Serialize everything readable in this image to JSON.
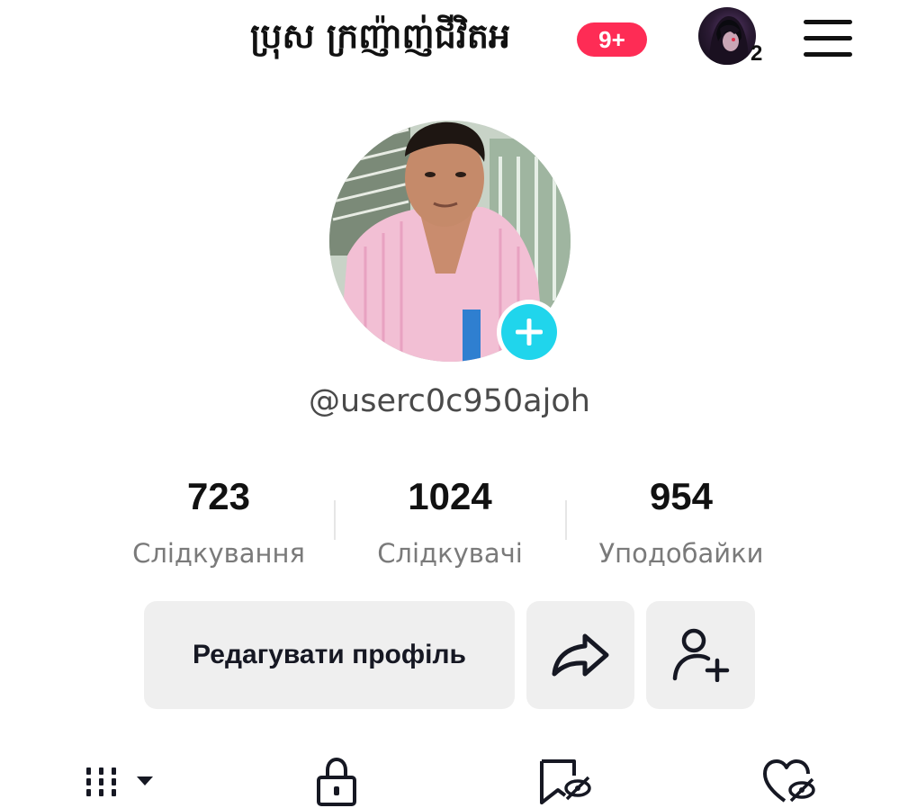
{
  "header": {
    "title": "ប្រុស ក្រញ៉ាញ់ជីវិតអ",
    "notification_badge": "9+",
    "account_count": "2"
  },
  "profile": {
    "username": "@userc0c950ajoh"
  },
  "stats": [
    {
      "value": "723",
      "label": "Слідкування"
    },
    {
      "value": "1024",
      "label": "Слідкувачі"
    },
    {
      "value": "954",
      "label": "Уподобайки"
    }
  ],
  "actions": {
    "edit_label": "Редагувати профіль"
  },
  "tabs": [
    {
      "icon": "videos-grid-icon"
    },
    {
      "icon": "lock-icon"
    },
    {
      "icon": "bookmark-hidden-icon"
    },
    {
      "icon": "heart-hidden-icon"
    }
  ],
  "colors": {
    "badge": "#fe2c55",
    "add_avatar": "#20d5ec",
    "button_bg": "#efefef",
    "label_gray": "#7a7a7a"
  }
}
